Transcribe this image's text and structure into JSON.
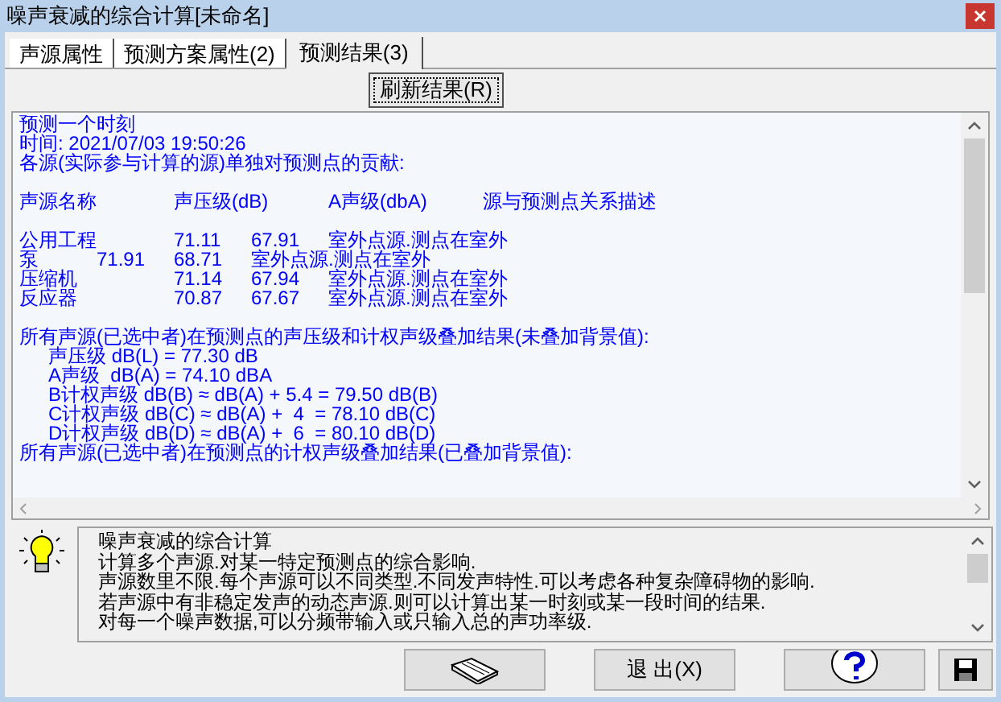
{
  "window": {
    "title": "噪声衰减的综合计算[未命名]"
  },
  "tabs": [
    {
      "label": "声源属性",
      "selected": false
    },
    {
      "label": "预测方案属性(2)",
      "selected": false
    },
    {
      "label": "预测结果(3)",
      "selected": true
    }
  ],
  "refresh_button": "刷新结果(R)",
  "result_lines": [
    {
      "text": "预测一个时刻",
      "kind": "plain"
    },
    {
      "text": "时间: 2021/07/03 19:50:26",
      "kind": "plain"
    },
    {
      "text": "各源(实际参与计算的源)单独对预测点的贡献:",
      "kind": "plain"
    },
    {
      "text": "声源名称\t声压级(dB)\tA声级(dbA)\t源与预测点关系描述",
      "kind": "plain",
      "gap_before": true
    },
    {
      "text": "公用工程\t71.11\t67.91\t室外点源.测点在室外",
      "kind": "plain",
      "gap_before": true
    },
    {
      "text": "泵\t71.91\t68.71\t室外点源.测点在室外",
      "kind": "plain"
    },
    {
      "text": "压缩机\t\t71.14\t67.94\t室外点源.测点在室外",
      "kind": "plain"
    },
    {
      "text": "反应器\t\t70.87\t67.67\t室外点源.测点在室外",
      "kind": "plain"
    },
    {
      "text": "所有声源(已选中者)在预测点的声压级和计权声级叠加结果(未叠加背景值):",
      "kind": "plain",
      "gap_before": true
    },
    {
      "text": "声压级 dB(L) = 77.30 dB",
      "kind": "indented"
    },
    {
      "text": "A声级  dB(A) = 74.10 dBA",
      "kind": "indented"
    },
    {
      "text": "B计权声级 dB(B) ≈ dB(A) + 5.4 = 79.50 dB(B)",
      "kind": "indented"
    },
    {
      "text": "C计权声级 dB(C) ≈ dB(A) +  4  = 78.10 dB(C)",
      "kind": "indented"
    },
    {
      "text": "D计权声级 dB(D) ≈ dB(A) +  6  = 80.10 dB(D)",
      "kind": "indented"
    },
    {
      "text": "所有声源(已选中者)在预测点的计权声级叠加结果(已叠加背景值):",
      "kind": "plain"
    }
  ],
  "info_lines": [
    "噪声衰减的综合计算",
    "计算多个声源.对某一特定预测点的综合影响.",
    "声源数里不限.每个声源可以不同类型.不同发声特性.可以考虑各种复杂障碍物的影响.",
    "若声源中有非稳定发声的动态声源.则可以计算出某一时刻或某一段时间的结果.",
    "对每一个噪声数据,可以分频带输入或只输入总的声功率级."
  ],
  "exit_button": "退 出(X)"
}
